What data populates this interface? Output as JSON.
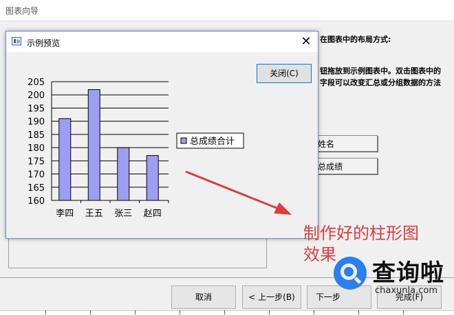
{
  "wizard": {
    "title": "图表向导",
    "text_line1": "在图表中的布局方式:",
    "text_line2": "钮拖放到示例图表中。双击图表中的",
    "text_line3": "字段可以改变汇总或分组数据的方法",
    "field1": "姓名",
    "field2": "总成绩",
    "cancel_label": "取消",
    "back_label": "< 上一步(B)",
    "next_label": "下一步",
    "finish_label": "完成(F)"
  },
  "dialog": {
    "title": "示例预览",
    "close_label": "关闭(C)",
    "close_glyph": "✕"
  },
  "chart_data": {
    "type": "bar",
    "categories": [
      "李四",
      "王五",
      "张三",
      "赵四"
    ],
    "series": [
      {
        "name": "总成绩合计",
        "values": [
          191,
          202,
          180,
          177
        ]
      }
    ],
    "ylim": [
      160,
      205
    ],
    "yticks": [
      160,
      165,
      170,
      175,
      180,
      185,
      190,
      195,
      200,
      205
    ],
    "grid": true,
    "legend_position": "right",
    "bar_color": "#9d9df2"
  },
  "annotation": {
    "line1": "制作好的柱形图",
    "line2": "效果",
    "color": "#e03c3c"
  },
  "logo": {
    "text": "查询啦",
    "sub": "chaxunla.com",
    "color": "#2b7ff0"
  }
}
